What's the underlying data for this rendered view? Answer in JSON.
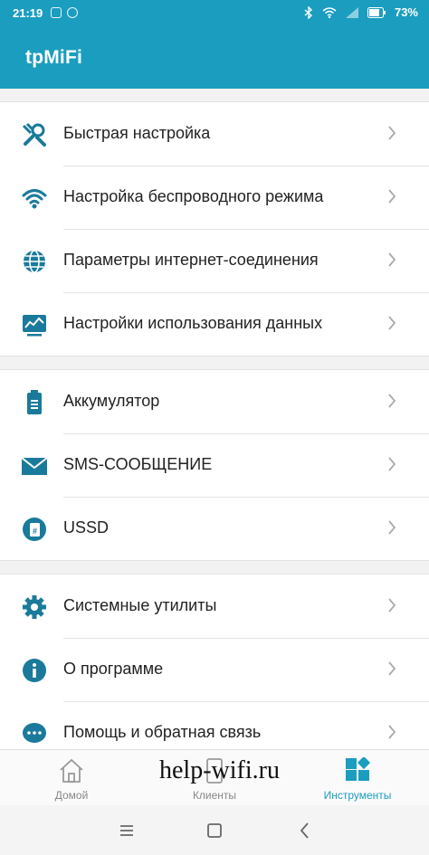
{
  "status": {
    "time": "21:19",
    "battery": "73%"
  },
  "app": {
    "title": "tpMiFi"
  },
  "sections": [
    {
      "items": [
        {
          "label": "Быстрая настройка",
          "icon": "wrench-icon"
        },
        {
          "label": "Настройка беспроводного режима",
          "icon": "wifi-icon"
        },
        {
          "label": "Параметры интернет-соединения",
          "icon": "globe-icon"
        },
        {
          "label": "Настройки использования данных",
          "icon": "data-usage-icon"
        }
      ]
    },
    {
      "items": [
        {
          "label": "Аккумулятор",
          "icon": "battery-icon"
        },
        {
          "label": "SMS-СООБЩЕНИЕ",
          "icon": "envelope-icon"
        },
        {
          "label": "USSD",
          "icon": "ussd-icon"
        }
      ]
    },
    {
      "items": [
        {
          "label": "Системные утилиты",
          "icon": "gear-icon"
        },
        {
          "label": "О программе",
          "icon": "info-icon"
        },
        {
          "label": "Помощь и обратная связь",
          "icon": "help-chat-icon"
        }
      ]
    }
  ],
  "tabs": [
    {
      "label": "Домой",
      "icon": "home-icon",
      "active": false
    },
    {
      "label": "Клиенты",
      "icon": "clients-icon",
      "active": false
    },
    {
      "label": "Инструменты",
      "icon": "tools-grid-icon",
      "active": true
    }
  ],
  "watermark": "help-wifi.ru",
  "colors": {
    "primary": "#1b9dc0",
    "icon": "#1a7a9b",
    "active_tab": "#1b9dc0"
  }
}
